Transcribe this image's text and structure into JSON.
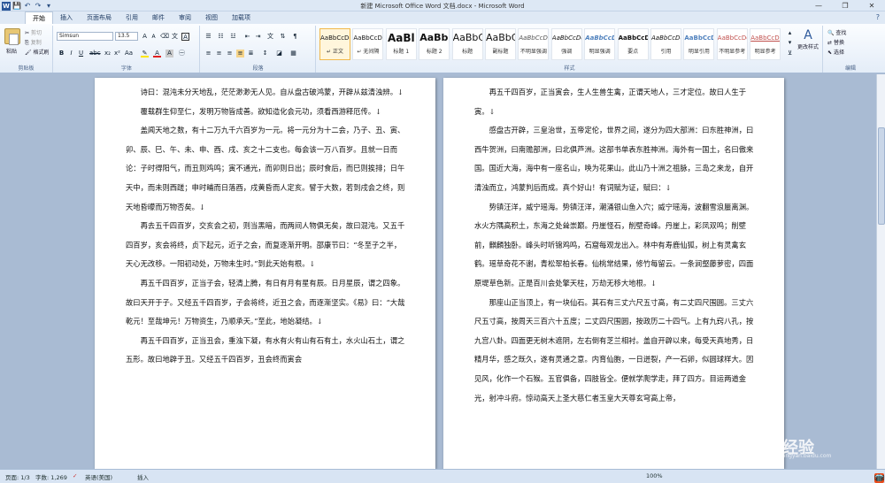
{
  "window": {
    "title": "新建 Microsoft Office Word 文档.docx - Microsoft Word",
    "qat": [
      "W",
      "💾",
      "↶",
      "↷",
      "▾"
    ],
    "controls": [
      "—",
      "❐",
      "✕"
    ]
  },
  "tabs": [
    "开始",
    "插入",
    "页面布局",
    "引用",
    "邮件",
    "审阅",
    "视图",
    "加载项"
  ],
  "ribbon": {
    "clipboard": {
      "label": "剪贴板",
      "paste": "粘贴",
      "cut": "剪切",
      "copy": "复制",
      "format_painter": "格式刷"
    },
    "font": {
      "label": "字体",
      "name": "Simsun",
      "size": "13.5"
    },
    "paragraph": {
      "label": "段落"
    },
    "styles": {
      "label": "样式",
      "items": [
        {
          "preview": "AaBbCcDd",
          "name": "↵ 正文"
        },
        {
          "preview": "AaBbCcDd",
          "name": "↵ 无间隔"
        },
        {
          "preview": "AaBl",
          "name": "标题 1"
        },
        {
          "preview": "AaBbC",
          "name": "标题 2"
        },
        {
          "preview": "AaBbC",
          "name": "标题"
        },
        {
          "preview": "AaBbC",
          "name": "副标题"
        },
        {
          "preview": "AaBbCcDd",
          "name": "不明显强调"
        },
        {
          "preview": "AaBbCcDd",
          "name": "强调"
        },
        {
          "preview": "AaBbCcDd",
          "name": "明显强调"
        },
        {
          "preview": "AaBbCcDd",
          "name": "要点"
        },
        {
          "preview": "AaBbCcDd",
          "name": "引用"
        },
        {
          "preview": "AaBbCcDd",
          "name": "明显引用"
        },
        {
          "preview": "AaBbCcDd",
          "name": "不明显参考"
        },
        {
          "preview": "AaBbCcDd",
          "name": "明显参考"
        }
      ],
      "change": "更改样式"
    },
    "editing": {
      "label": "编辑",
      "find": "查找",
      "replace": "替换",
      "select": "选择"
    }
  },
  "left_page": [
    "诗曰：混沌未分天地乱，茫茫渺渺无人见。自从盘古破鸿蒙，开辟从兹清浊辨。↓",
    "覆载群生仰至仁，发明万物皆成善。欲知造化会元功，须看西游释厄传。↓",
    "盖闻天地之数，有十二万九千六百岁为一元。将一元分为十二会，乃子、丑、寅、卯、辰、巳、午、未、申、酉、戌、亥之十二支也。每会该一万八百岁。且就一日而论：子时得阳气，而丑则鸡鸣；寅不通光，而卯则日出；辰时食后，而巳则挨排；日午天中，而未则西蹉；申时晡而日落酉，戌黄昏而人定亥。譬于大数，若到戌会之终，则天地昏曚而万物否矣。↓",
    "再去五千四百岁，交亥会之初，则当黑暗，而两间人物俱无矣，故曰混沌。又五千四百岁，亥会将终，贞下起元，近子之会，而复逐渐开明。邵康节曰：“冬至子之半，天心无改移。一阳初动处，万物未生时。”到此天始有根。↓",
    "再五千四百岁，正当子会，轻清上腾，有日有月有星有辰。日月星辰，谓之四象。故曰天开于子。又经五千四百岁，子会将终，近丑之会，而逐渐坚实。《易》曰：“大哉乾元！至哉坤元！万物资生，乃顺承天。”至此，地始凝结。↓",
    "再五千四百岁，正当丑会，重浊下凝，有水有火有山有石有土，水火山石土，谓之五形。故曰地辟于丑。又经五千四百岁，丑会终而寅会"
  ],
  "right_page": [
    "再五千四百岁，正当寅会，生人生兽生禽，正谓天地人，三才定位。故曰人生于寅。↓",
    "感盘古开辟，三皇治世，五帝定伦，世界之间，遂分为四大部洲：曰东胜神洲，曰西牛贺洲，曰南赡部洲，曰北俱芦洲。这部书单表东胜神洲。海外有一国土，名曰傲来国。国近大海，海中有一座名山，唤为花果山。此山乃十洲之祖脉，三岛之来龙，自开清浊而立，鸿蒙判后而成。真个好山！有词赋为证，赋曰：↓",
    "势镇汪洋，威宁瑶海。势镇汪洋，潮涌银山鱼入穴；威宁瑶海，波翻雪浪蜃离渊。水火方隅高积土，东海之处耸崇巅。丹崖怪石，削壁奇峰。丹崖上，彩凤双鸣；削壁前，麒麟独卧。峰头时听锦鸡鸣，石窟每观龙出入。林中有寿鹿仙狐，树上有灵禽玄鹤。瑶草奇花不谢，青松翠柏长春。仙桃常结果，修竹每留云。一条涧壑藤萝密，四面原堤草色新。正是百川会处擎天柱，万劫无移大地根。↓",
    "那座山正当顶上，有一块仙石。其石有三丈六尺五寸高，有二丈四尺围圆。三丈六尺五寸高，按周天三百六十五度；二丈四尺围圆，按政历二十四气。上有九窍八孔，按九宫八卦。四面更无树木遮阴，左右倒有芝兰相衬。盖自开辟以来，每受天真地秀，日精月华，感之既久，遂有灵通之意。内育仙胞，一日迸裂，产一石卵，似圆球样大。因见风，化作一个石猴。五官俱备，四肢皆全。便就学爬学走，拜了四方。目运两道金光，射冲斗府。惊动高天上圣大慈仁者玉皇大天尊玄穹高上帝，"
  ],
  "status": {
    "page": "页面: 1/3",
    "words": "字数: 1,269",
    "lang": "英语(美国)",
    "mode": "插入",
    "zoom": "100%"
  },
  "watermark": {
    "text": "经验",
    "sub": "jingyan.baidu.com"
  },
  "tray": {
    "ime": "S",
    "lang": "中"
  },
  "colors": {
    "ribbon_bg": "#e4edf8",
    "doc_bg": "#a9bbd3",
    "accent": "#f1b84a"
  }
}
